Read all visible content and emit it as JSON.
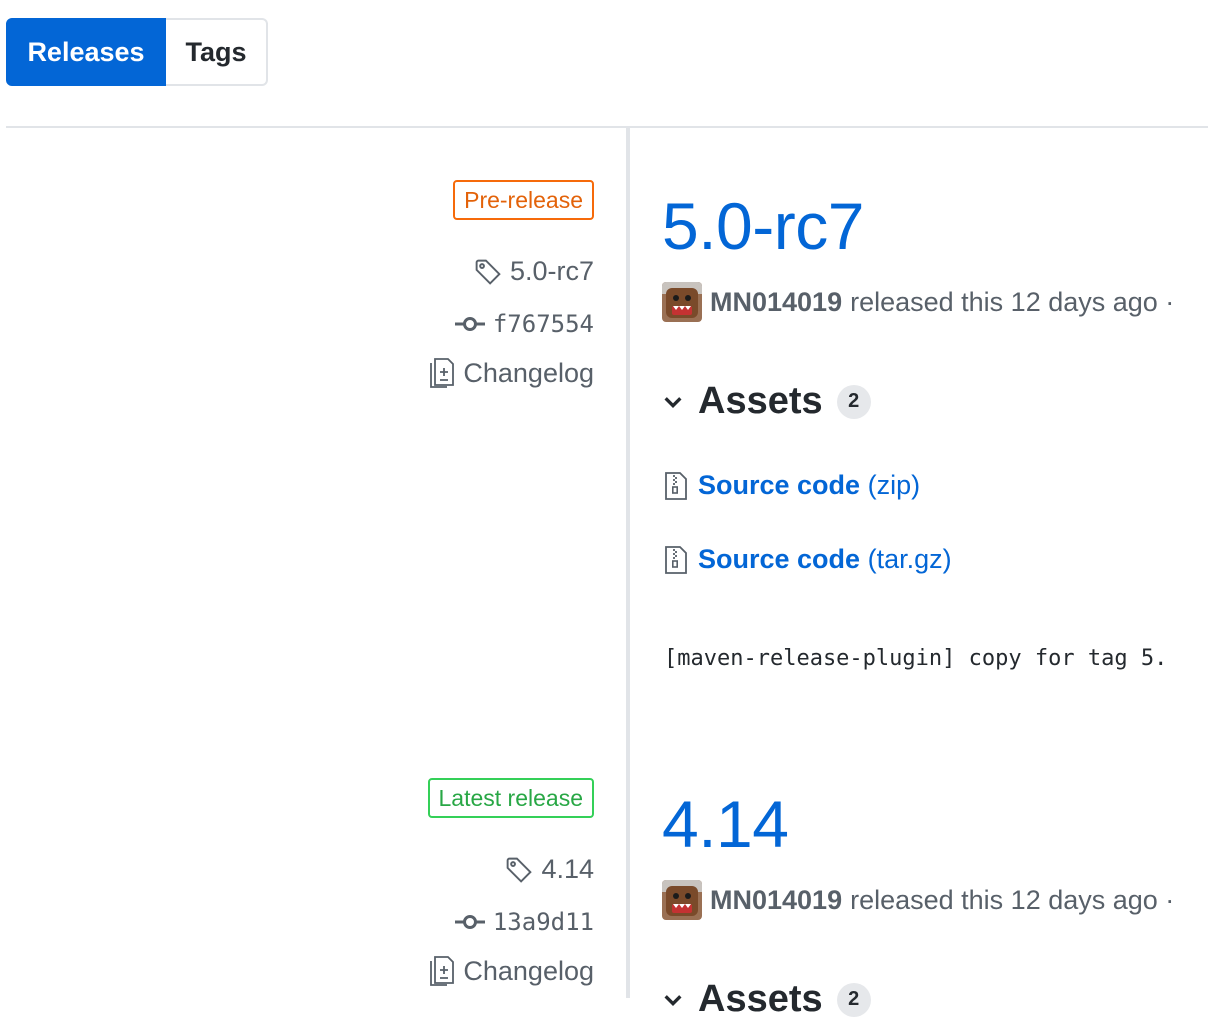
{
  "tabs": [
    {
      "label": "Releases",
      "active": true
    },
    {
      "label": "Tags",
      "active": false
    }
  ],
  "releases": [
    {
      "badge": "Pre-release",
      "badge_kind": "pre",
      "tag": "5.0-rc7",
      "commit": "f767554",
      "changelog_label": "Changelog",
      "title": "5.0-rc7",
      "author": "MN014019",
      "released_text": "released this 12 days ago ·",
      "assets_label": "Assets",
      "assets_count": "2",
      "assets": [
        {
          "name": "Source code",
          "format": "(zip)"
        },
        {
          "name": "Source code",
          "format": "(tar.gz)"
        }
      ],
      "body": "[maven-release-plugin] copy for tag 5."
    },
    {
      "badge": "Latest release",
      "badge_kind": "latest",
      "tag": "4.14",
      "commit": "13a9d11",
      "changelog_label": "Changelog",
      "title": "4.14",
      "author": "MN014019",
      "released_text": "released this 12 days ago ·",
      "assets_label": "Assets",
      "assets_count": "2"
    }
  ],
  "colors": {
    "accent": "#0366d6",
    "prerelease": "#e36209",
    "latest": "#28a745",
    "muted": "#586069",
    "border": "#e1e4e8"
  },
  "icons": {
    "tag": "tag-icon",
    "commit": "git-commit-icon",
    "changelog": "file-diff-icon",
    "asset": "file-zip-icon",
    "chevron": "chevron-down-icon"
  }
}
